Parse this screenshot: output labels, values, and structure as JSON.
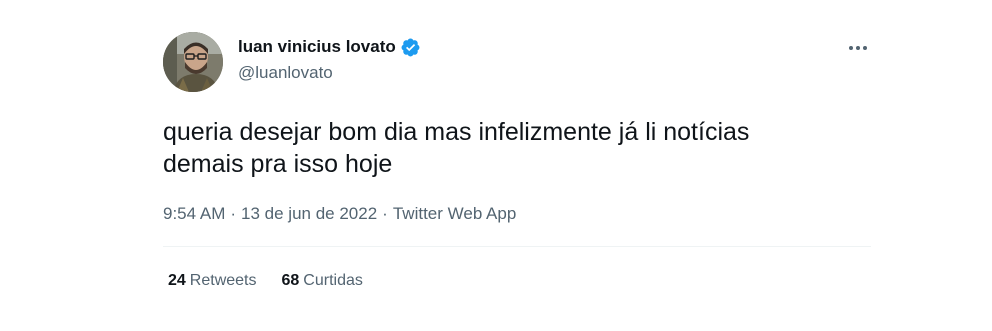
{
  "author": {
    "display_name": "luan vinicius lovato",
    "handle": "@luanlovato",
    "avatar_icon": "profile-photo",
    "verified_icon": "verified-badge-icon",
    "verified_color": "#1d9bf0"
  },
  "more_icon": "more-options-icon",
  "tweet": {
    "text": "queria desejar bom dia mas infelizmente já li notícias\ndemais pra isso hoje"
  },
  "meta": {
    "time": "9:54 AM",
    "separator": "·",
    "date": "13 de jun de 2022",
    "source": "Twitter Web App"
  },
  "stats": {
    "retweets_count": "24",
    "retweets_label": "Retweets",
    "likes_count": "68",
    "likes_label": "Curtidas"
  }
}
